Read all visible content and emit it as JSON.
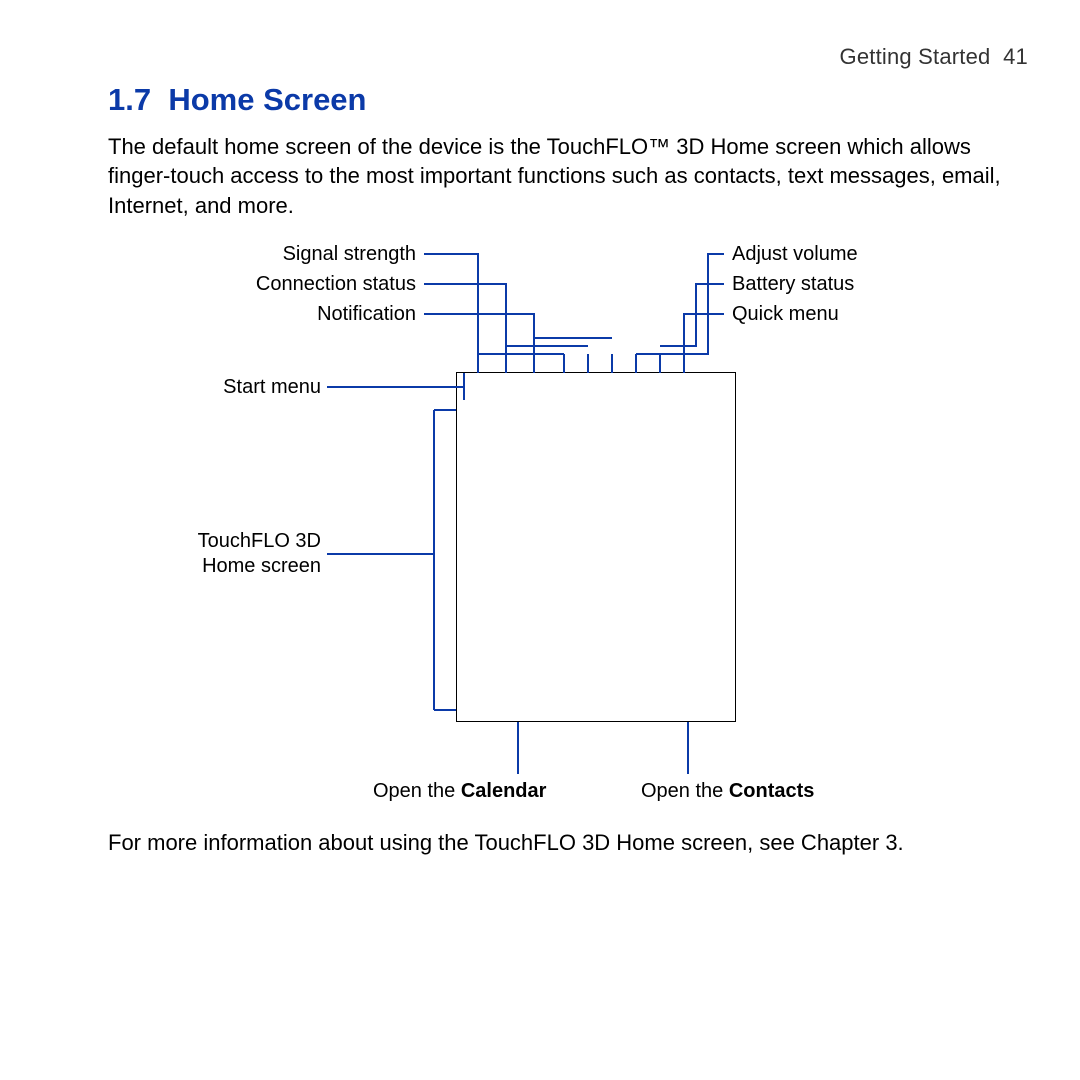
{
  "header": {
    "chapter": "Getting Started",
    "page_number": "41"
  },
  "section": {
    "number": "1.7",
    "title": "Home Screen"
  },
  "intro": "The default home screen of the device is the TouchFLO™ 3D Home screen which allows finger-touch access to the most important functions such as contacts, text messages, email, Internet, and more.",
  "labels": {
    "top_left": [
      "Signal strength",
      "Connection status",
      "Notification"
    ],
    "top_right": [
      "Adjust volume",
      "Battery status",
      "Quick menu"
    ],
    "left": [
      "Start menu",
      "TouchFLO 3D",
      "Home screen"
    ],
    "bottom": {
      "calendar_prefix": "Open the ",
      "calendar_bold": "Calendar",
      "contacts_prefix": "Open the ",
      "contacts_bold": "Contacts"
    }
  },
  "footer": "For more information about using the TouchFLO 3D Home screen, see Chapter 3.",
  "colors": {
    "accent": "#0b3aa8"
  }
}
